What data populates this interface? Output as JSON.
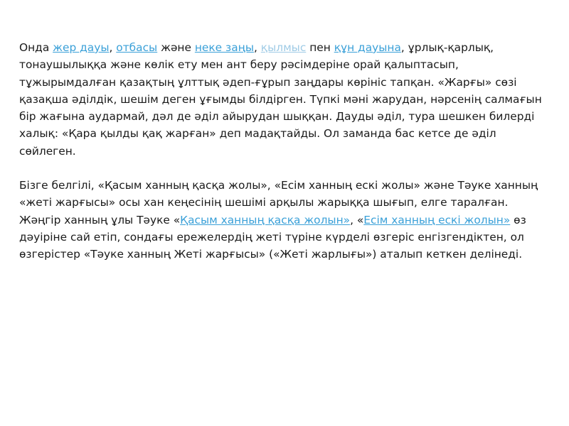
{
  "paragraph1": {
    "t0": "Онда ",
    "link_zher_dauy": "жер дауы",
    "t1": ", ",
    "link_otbasy": "отбасы",
    "t2": " және ",
    "link_neke_zany": "неке заңы",
    "t3": ", ",
    "link_kylmys": "қылмыс",
    "t4": " пен ",
    "link_kun_dauyna": "құн дауына",
    "t5": ", ұрлық-қарлық, тонаушылыққа және көлік ету мен ант беру рәсімдеріне орай қалыптасып, тұжырымдалған қазақтың ұлттық әдеп-ғұрып заңдары көрініс тапқан. «Жарғы» сөзі қазақша әділдік, шешім деген ұғымды білдірген. Түпкі мәні жарудан, нәрсенің салмағын бір жағына аудармай, дәл де әділ айырудан шыққан. Дауды әділ, тура шешкен билерді халық: «Қара қылды қақ жарған» деп мадақтайды. Ол заманда бас кетсе де әділ сөйлеген."
  },
  "paragraph2": {
    "t0": "Бізге белгілі, «Қасым ханның қасқа жолы», «Есім ханның ескі жолы» және Тәуке ханның «жеті жарғысы» осы хан кеңесінің шешімі арқылы жарыққа шығып, елге таралған. Жәңгір ханның ұлы Тәуке «",
    "link_kasym": "Қасым ханның қасқа жолын»",
    "t1": ", «",
    "link_esim": "Есім ханның ескі жолын»",
    "t2": " өз дәуіріне сай етіп, сондағы ережелердің жеті түріне күрделі өзгеріс енгізгендіктен, ол өзгерістер «Тәуке ханның Жеті жарғысы» («Жеті жарлығы») аталып кеткен делінеді."
  },
  "colors": {
    "text": "#1a1a1a",
    "link": "#3aa0d8",
    "link_faded": "#9fcbe6",
    "background": "#ffffff"
  }
}
